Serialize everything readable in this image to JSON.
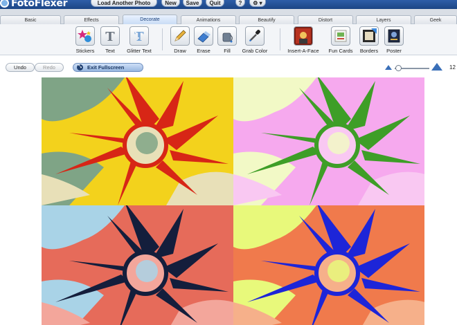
{
  "app": {
    "logo_text": "FotoFlexer"
  },
  "topbar": {
    "load_label": "Load Another Photo",
    "new_label": "New",
    "save_label": "Save",
    "quit_label": "Quit",
    "help_label": "?",
    "settings_label": "⚙ ▾"
  },
  "tabs": [
    {
      "label": "Basic"
    },
    {
      "label": "Effects"
    },
    {
      "label": "Decorate"
    },
    {
      "label": "Animations"
    },
    {
      "label": "Beautify"
    },
    {
      "label": "Distort"
    },
    {
      "label": "Layers"
    },
    {
      "label": "Geek"
    }
  ],
  "active_tab": "Decorate",
  "tools": [
    {
      "label": "Stickers",
      "icon": "stickers-icon"
    },
    {
      "label": "Text",
      "icon": "text-icon"
    },
    {
      "label": "Glitter Text",
      "icon": "glitter-text-icon"
    },
    {
      "label": "Draw",
      "icon": "pencil-icon"
    },
    {
      "label": "Erase",
      "icon": "eraser-icon"
    },
    {
      "label": "Fill",
      "icon": "paint-bucket-icon"
    },
    {
      "label": "Grab Color",
      "icon": "eyedropper-icon"
    },
    {
      "label": "Insert-A-Face",
      "icon": "face-icon"
    },
    {
      "label": "Fun Cards",
      "icon": "cards-icon"
    },
    {
      "label": "Borders",
      "icon": "borders-icon"
    },
    {
      "label": "Poster",
      "icon": "poster-icon"
    }
  ],
  "controls": {
    "undo_label": "Undo",
    "redo_label": "Redo",
    "exit_fullscreen_label": "Exit Fullscreen",
    "zoom_value": "12"
  },
  "colors": {
    "accent": "#2e5ea8",
    "tab_bg": "#d9dee5"
  },
  "canvas": {
    "quadrants": [
      {
        "bg": "#f3d21c",
        "accent1": "#7fa486",
        "accent2": "#e8e0b8",
        "flower": "#d72616"
      },
      {
        "bg": "#f6a9ee",
        "accent1": "#f2f9c6",
        "accent2": "#f9c8f2",
        "flower": "#3e9e27"
      },
      {
        "bg": "#e66b5a",
        "accent1": "#a9d3e7",
        "accent2": "#f3a69b",
        "flower": "#141e3c"
      },
      {
        "bg": "#f07a4c",
        "accent1": "#e8f97b",
        "accent2": "#f6b08a",
        "flower": "#1d25d8"
      }
    ]
  }
}
